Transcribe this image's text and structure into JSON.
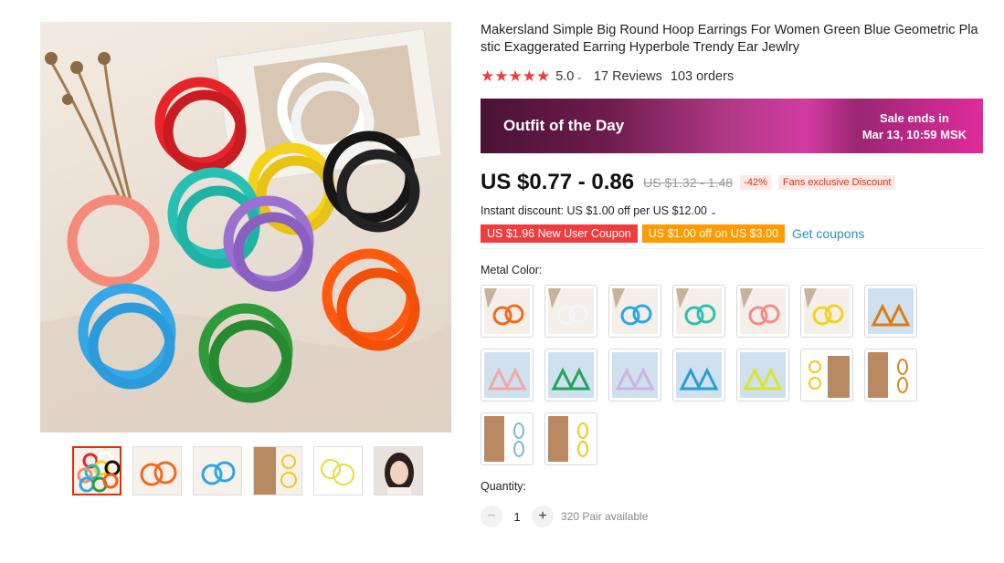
{
  "product": {
    "title": "Makersland Simple Big Round Hoop Earrings For Women Green Blue Geometric Plastic Exaggerated Earring Hyperbole Trendy Ear Jewlry",
    "rating_stars": "★★★★★",
    "rating_value": "5.0",
    "reviews": "17 Reviews",
    "orders": "103 orders"
  },
  "banner": {
    "title": "Outfit of the Day",
    "sale_line1": "Sale ends in",
    "sale_line2": "Mar 13, 10:59 MSK"
  },
  "price": {
    "current": "US $0.77 - 0.86",
    "original": "US $1.32 - 1.48",
    "discount": "-42%",
    "fans_badge": "Fans exclusive Discount"
  },
  "instant_discount": "Instant discount: US $1.00 off per US $12.00",
  "coupons": {
    "new_user": "US $1.96 New User Coupon",
    "store": "US $1.00 off on US $3.00",
    "get_label": "Get coupons"
  },
  "options": {
    "color_label": "Metal Color:",
    "swatch_colors": [
      "#f26a1b",
      "#f4f4f4",
      "#2aa8e0",
      "#2dc2b0",
      "#f58a86",
      "#f2d21b",
      "#e07a10",
      "#f4a7a7",
      "#23a35a",
      "#c9b5e0",
      "#2a9fd1",
      "#d8e62a",
      "#f2c81b",
      "#e0841b",
      "#7ab8e0",
      "#f2c81b"
    ],
    "swatch_icons": [
      "hoop-orange-icon",
      "hoop-white-icon",
      "hoop-blue-icon",
      "hoop-teal-icon",
      "hoop-pink-icon",
      "hoop-yellow-icon",
      "triangle-orange-icon",
      "triangle-pink-icon",
      "triangle-green-icon",
      "triangle-lilac-icon",
      "triangle-blue-icon",
      "triangle-lime-icon",
      "flower-yellow-icon",
      "oval-orange-icon",
      "oval-blue-icon",
      "oval-yellow-icon"
    ]
  },
  "quantity": {
    "label": "Quantity:",
    "minus": "−",
    "value": "1",
    "plus": "+",
    "available": "320 Pair available"
  },
  "gallery": {
    "thumb_icons": [
      "earrings-collection-icon",
      "orange-hoops-icon",
      "blue-hoops-icon",
      "gold-hoops-model-icon",
      "yellow-hoops-icon",
      "model-portrait-icon"
    ]
  }
}
